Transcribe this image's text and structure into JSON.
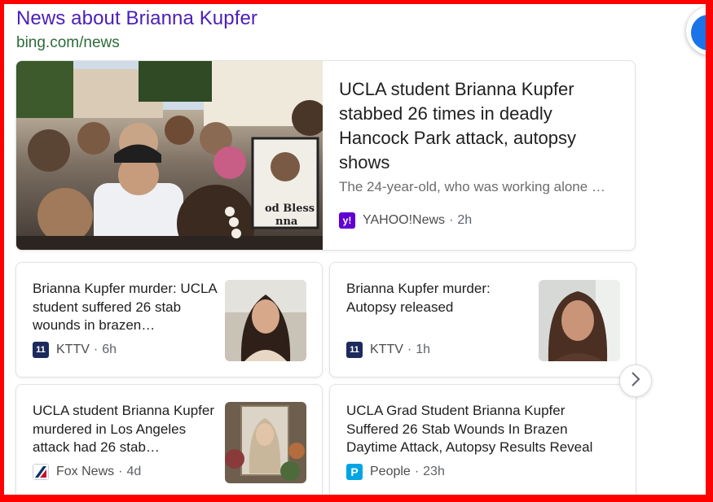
{
  "header": {
    "title": "News about Brianna Kupfer",
    "source": "bing.com/news"
  },
  "hero": {
    "title": "UCLA student Brianna Kupfer stabbed 26 times in deadly Hancock Park attack, autopsy shows",
    "snippet": "The 24-year-old, who was working alone …",
    "source": "YAHOO!News",
    "time": "2h",
    "logo_text": "y!",
    "sign_text": "od Bless\nnna",
    "colors": {
      "logo": "#6001d2"
    }
  },
  "cards": [
    {
      "title": "Brianna Kupfer murder: UCLA student suffered 26 stab wounds in brazen…",
      "source": "KTTV",
      "time": "6h",
      "logo_text": "11",
      "logo_icon": "fox11-icon",
      "colors": {
        "logo": "#1c2a5c"
      }
    },
    {
      "title": "Brianna Kupfer murder: Autopsy released",
      "source": "KTTV",
      "time": "1h",
      "logo_text": "11",
      "logo_icon": "fox11-icon",
      "colors": {
        "logo": "#1c2a5c"
      }
    },
    {
      "title": "UCLA student Brianna Kupfer murdered in Los Angeles attack had 26 stab…",
      "source": "Fox News",
      "time": "4d",
      "logo_icon": "foxnews-icon",
      "colors": {
        "logo": "#003366"
      }
    },
    {
      "title": "UCLA Grad Student Brianna Kupfer Suffered 26 Stab Wounds In Brazen Daytime Attack, Autopsy Results Reveal",
      "source": "People",
      "time": "23h",
      "logo_text": "P",
      "logo_icon": "people-icon",
      "colors": {
        "logo": "#00a4e4"
      }
    }
  ],
  "nav": {
    "next_icon": "chevron-right-icon"
  },
  "colors": {
    "frame": "#ff0000",
    "title_link": "#4a1fb8",
    "source_url": "#2e6b3a"
  }
}
